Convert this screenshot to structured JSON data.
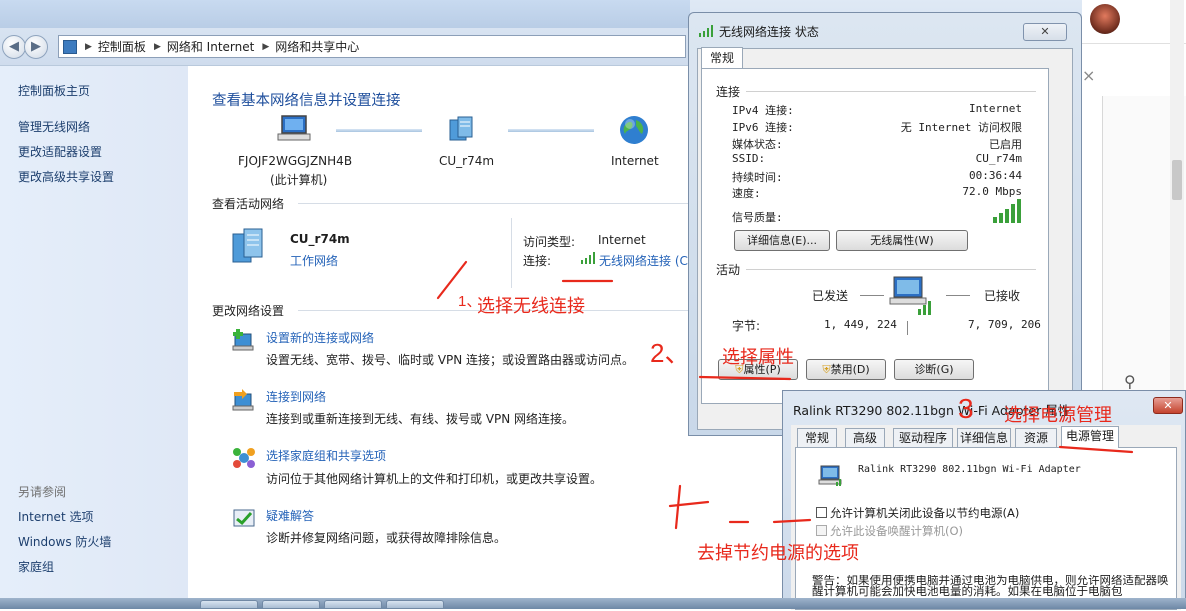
{
  "breadcrumb": [
    "控制面板",
    "网络和 Internet",
    "网络和共享中心"
  ],
  "left_pane": {
    "home": "控制面板主页",
    "links": [
      "管理无线网络",
      "更改适配器设置",
      "更改高级共享设置"
    ],
    "see_also_title": "另请参阅",
    "see_also": [
      "Internet 选项",
      "Windows 防火墙",
      "家庭组"
    ]
  },
  "main": {
    "title": "查看基本网络信息并设置连接",
    "map": {
      "computer_name": "FJOJF2WGGJZNH4B",
      "computer_note": "(此计算机)",
      "network_name": "CU_r74m",
      "internet": "Internet"
    },
    "active_title": "查看活动网络",
    "active": {
      "name": "CU_r74m",
      "type": "工作网络",
      "access_label": "访问类型:",
      "access_value": "Internet",
      "conn_label": "连接:",
      "conn_value": "无线网络连接 (C"
    },
    "change_title": "更改网络设置",
    "tasks": [
      {
        "title": "设置新的连接或网络",
        "desc": "设置无线、宽带、拨号、临时或 VPN 连接；或设置路由器或访问点。"
      },
      {
        "title": "连接到网络",
        "desc": "连接到或重新连接到无线、有线、拨号或 VPN 网络连接。"
      },
      {
        "title": "选择家庭组和共享选项",
        "desc": "访问位于其他网络计算机上的文件和打印机，或更改共享设置。"
      },
      {
        "title": "疑难解答",
        "desc": "诊断并修复网络问题，或获得故障排除信息。"
      }
    ]
  },
  "status_dialog": {
    "title": "无线网络连接 状态",
    "tab": "常规",
    "connection_group": "连接",
    "rows": [
      {
        "label": "IPv4 连接:",
        "value": "Internet"
      },
      {
        "label": "IPv6 连接:",
        "value": "无 Internet 访问权限"
      },
      {
        "label": "媒体状态:",
        "value": "已启用"
      },
      {
        "label": "SSID:",
        "value": "CU_r74m"
      },
      {
        "label": "持续时间:",
        "value": "00:36:44"
      },
      {
        "label": "速度:",
        "value": "72.0 Mbps"
      }
    ],
    "signal_label": "信号质量:",
    "details_button": "详细信息(E)...",
    "wireless_props_button": "无线属性(W)",
    "activity_group": "活动",
    "sent_label": "已发送",
    "recv_label": "已接收",
    "bytes_label": "字节:",
    "bytes_sent": "1, 449, 224",
    "bytes_recv": "7, 709, 206",
    "properties_button": "属性(P)",
    "disable_button": "禁用(D)",
    "diagnose_button": "诊断(G)"
  },
  "adapter_dialog": {
    "title": "Ralink RT3290 802.11bgn Wi-Fi Adapter 属性",
    "tabs": [
      "常规",
      "高级",
      "驱动程序",
      "详细信息",
      "资源",
      "电源管理"
    ],
    "active_tab": "电源管理",
    "device": "Ralink RT3290 802.11bgn Wi-Fi Adapter",
    "option1": "允许计算机关闭此设备以节约电源(A)",
    "option2": "允许此设备唤醒计算机(O)",
    "warning": "警告：如果使用便携电脑并通过电池为电脑供电，则允许网络适配器唤醒计算机可能会加快电池电量的消耗。如果在电脑位于电脑包"
  },
  "annotations": {
    "a1_num": "1、",
    "a1_text": "选择无线连接",
    "a2_num": "2、",
    "a2_text": "选择属性",
    "a3_num": "3",
    "a3_text": "选择电源管理",
    "a4_num": "4—",
    "a4_text": "去掉节约电源的选项"
  },
  "colors": {
    "annotation": "#e8291c",
    "link": "#2563b8",
    "title": "#1e4e9c"
  }
}
